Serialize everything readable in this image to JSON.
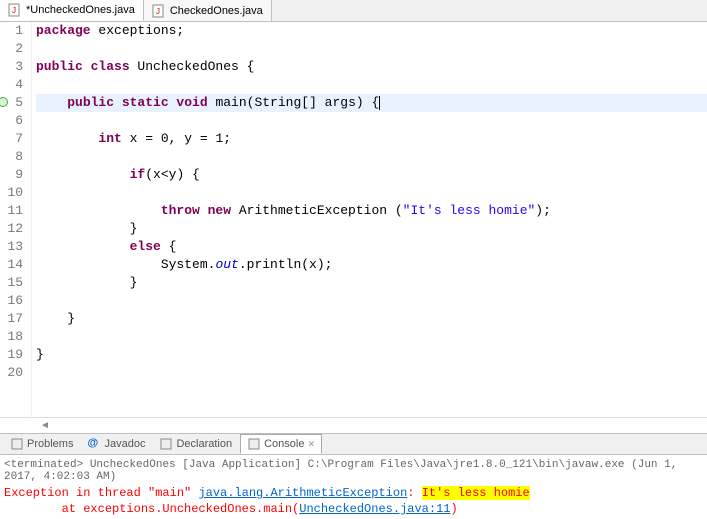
{
  "tabs": [
    {
      "label": "*UncheckedOnes.java",
      "active": true
    },
    {
      "label": "CheckedOnes.java",
      "active": false
    }
  ],
  "code": {
    "lines": [
      {
        "n": 1,
        "seg": [
          {
            "t": "package ",
            "c": "kw"
          },
          {
            "t": "exceptions;"
          }
        ]
      },
      {
        "n": 2,
        "seg": []
      },
      {
        "n": 3,
        "seg": [
          {
            "t": "public class ",
            "c": "kw"
          },
          {
            "t": "UncheckedOnes {"
          }
        ]
      },
      {
        "n": 4,
        "seg": []
      },
      {
        "n": 5,
        "hl": true,
        "marker": "green",
        "seg": [
          {
            "t": "    "
          },
          {
            "t": "public static void ",
            "c": "kw"
          },
          {
            "t": "main(String[] args) {"
          }
        ]
      },
      {
        "n": 6,
        "seg": []
      },
      {
        "n": 7,
        "seg": [
          {
            "t": "        "
          },
          {
            "t": "int ",
            "c": "kw"
          },
          {
            "t": "x = 0, y = 1;"
          }
        ]
      },
      {
        "n": 8,
        "seg": []
      },
      {
        "n": 9,
        "seg": [
          {
            "t": "            "
          },
          {
            "t": "if",
            "c": "kw"
          },
          {
            "t": "(x<y) {"
          }
        ]
      },
      {
        "n": 10,
        "seg": []
      },
      {
        "n": 11,
        "seg": [
          {
            "t": "                "
          },
          {
            "t": "throw new ",
            "c": "kw"
          },
          {
            "t": "ArithmeticException ("
          },
          {
            "t": "\"It's less homie\"",
            "c": "str"
          },
          {
            "t": ");"
          }
        ]
      },
      {
        "n": 12,
        "seg": [
          {
            "t": "            }"
          }
        ]
      },
      {
        "n": 13,
        "seg": [
          {
            "t": "            "
          },
          {
            "t": "else ",
            "c": "kw"
          },
          {
            "t": "{"
          }
        ]
      },
      {
        "n": 14,
        "seg": [
          {
            "t": "                System."
          },
          {
            "t": "out",
            "c": "fld"
          },
          {
            "t": ".println(x);"
          }
        ]
      },
      {
        "n": 15,
        "seg": [
          {
            "t": "            }"
          }
        ]
      },
      {
        "n": 16,
        "seg": []
      },
      {
        "n": 17,
        "seg": [
          {
            "t": "    }"
          }
        ]
      },
      {
        "n": 18,
        "seg": []
      },
      {
        "n": 19,
        "seg": [
          {
            "t": "}"
          }
        ]
      },
      {
        "n": 20,
        "seg": []
      }
    ]
  },
  "bottom_tabs": [
    {
      "label": "Problems"
    },
    {
      "label": "Javadoc",
      "prefix": "@"
    },
    {
      "label": "Declaration"
    },
    {
      "label": "Console",
      "active": true,
      "closable": true
    }
  ],
  "console": {
    "header_prefix": "<terminated> ",
    "header_app": "UncheckedOnes [Java Application] C:\\Program Files\\Java\\jre1.8.0_121\\bin\\javaw.exe (Jun 1, 2017, 4:02:03 AM)",
    "line1_a": "Exception in thread \"main\" ",
    "line1_link": "java.lang.ArithmeticException",
    "line1_b": ": ",
    "line1_hl": "It's less homie",
    "line2_a": "\tat exceptions.UncheckedOnes.main(",
    "line2_link": "UncheckedOnes.java:11",
    "line2_b": ")"
  }
}
